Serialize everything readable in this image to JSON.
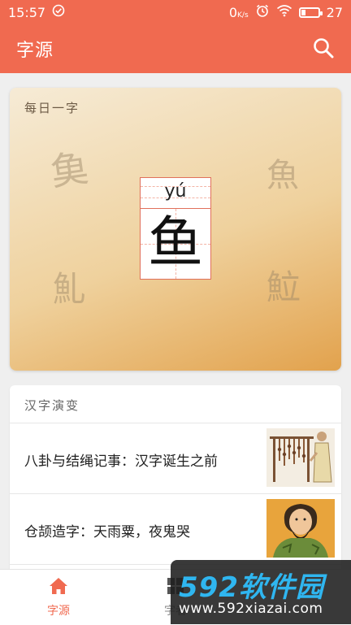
{
  "status_bar": {
    "time": "15:57",
    "net_speed": "0",
    "net_unit": "K/s",
    "battery": "27",
    "battery_level": 0.27
  },
  "app_bar": {
    "title": "字源"
  },
  "daily_card": {
    "title": "每日一字",
    "pinyin": "yú",
    "character": "鱼",
    "ancient_forms": [
      "𩵋",
      "魚",
      "䰲",
      "𩶘"
    ]
  },
  "evolution": {
    "title": "汉字演变",
    "articles": [
      {
        "title": "八卦与结绳记事：汉字诞生之前"
      },
      {
        "title": "仓颉造字：天雨粟，夜鬼哭"
      }
    ]
  },
  "bottom_nav": {
    "items": [
      {
        "label": "字源",
        "icon": "home-icon"
      },
      {
        "label": "字者",
        "icon": "grid-icon"
      }
    ]
  },
  "watermark": {
    "brand": "592软件园",
    "url": "www.592xiazai.com"
  },
  "colors": {
    "accent": "#f06a50",
    "card_gradient_end": "#e2a24d"
  }
}
